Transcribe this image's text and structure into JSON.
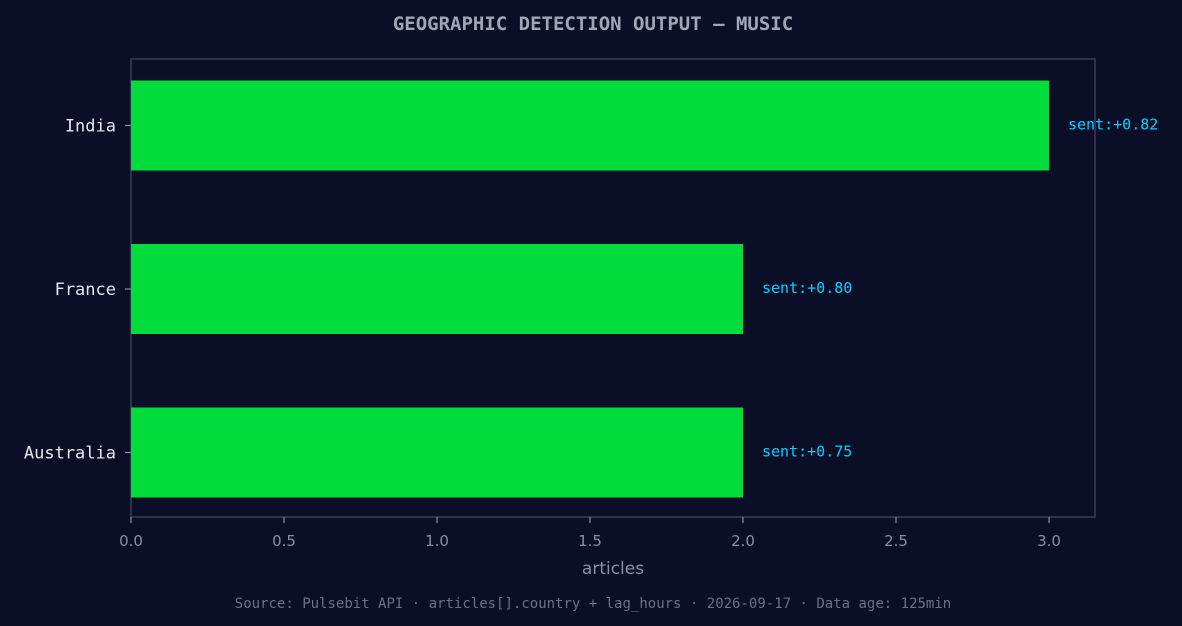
{
  "chart_data": {
    "type": "bar",
    "orientation": "horizontal",
    "title": "GEOGRAPHIC DETECTION OUTPUT — MUSIC",
    "xlabel": "articles",
    "ylabel": "",
    "categories": [
      "India",
      "France",
      "Australia"
    ],
    "values": [
      3,
      2,
      2
    ],
    "annotations": [
      "sent:+0.82",
      "sent:+0.80",
      "sent:+0.75"
    ],
    "xlim": [
      0,
      3.15
    ],
    "xticks": [
      "0.0",
      "0.5",
      "1.0",
      "1.5",
      "2.0",
      "2.5",
      "3.0"
    ],
    "grid": false,
    "legend": "none"
  },
  "source": "Source: Pulsebit API · articles[].country + lag_hours · 2026-09-17 · Data age: 125min",
  "colors": {
    "background": "#0a0e27",
    "bar": "#00dc3c",
    "annotation": "#00d4ff",
    "title": "#a0a6b8",
    "category_text": "#e8e8f0",
    "tick_text": "#8a8fa3",
    "axis": "#3a3f5c",
    "source_text": "#6b7089"
  }
}
